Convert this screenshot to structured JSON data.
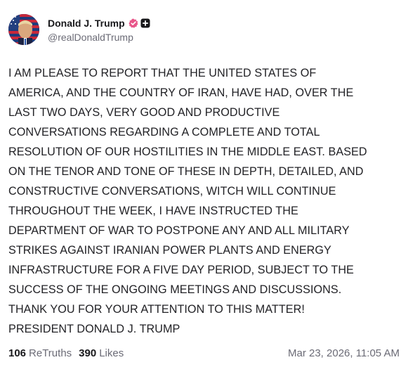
{
  "author": {
    "display_name": "Donald J. Trump",
    "handle": "@realDonaldTrump",
    "avatar_icon": "profile-photo-flag-background",
    "verified_icon": "verified-badge-icon",
    "verified_color": "#e8578a",
    "plus_icon": "plus-badge-icon"
  },
  "post": {
    "text": "I AM PLEASE TO REPORT THAT THE UNITED STATES OF\nAMERICA, AND THE COUNTRY OF IRAN, HAVE HAD, OVER THE\nLAST TWO DAYS, VERY GOOD AND PRODUCTIVE\nCONVERSATIONS REGARDING A COMPLETE AND TOTAL\nRESOLUTION OF OUR HOSTILITIES IN THE MIDDLE EAST. BASED\nON THE TENOR AND TONE OF THESE IN DEPTH, DETAILED, AND\nCONSTRUCTIVE CONVERSATIONS, WITCH WILL CONTINUE\nTHROUGHOUT THE WEEK, I HAVE INSTRUCTED THE\nDEPARTMENT OF WAR TO POSTPONE ANY AND ALL MILITARY\nSTRIKES AGAINST IRANIAN POWER PLANTS AND ENERGY\nINFRASTRUCTURE FOR A FIVE DAY PERIOD, SUBJECT TO THE\nSUCCESS OF THE ONGOING MEETINGS AND DISCUSSIONS.\nTHANK YOU FOR YOUR ATTENTION TO THIS MATTER!\nPRESIDENT DONALD J. TRUMP"
  },
  "stats": {
    "retruths_count": "106",
    "retruths_label": "ReTruths",
    "likes_count": "390",
    "likes_label": "Likes"
  },
  "timestamp": "Mar 23, 2026, 11:05 AM"
}
